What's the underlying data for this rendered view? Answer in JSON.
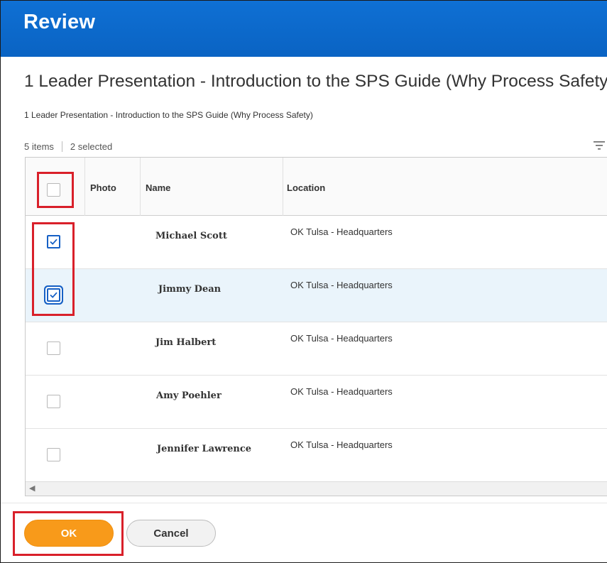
{
  "header": {
    "title": "Review"
  },
  "main_title": "1 Leader Presentation - Introduction to the SPS Guide (Why Process Safety",
  "subtitle": "1 Leader Presentation - Introduction to the SPS Guide (Why Process Safety)",
  "grid": {
    "item_count": "5 items",
    "selected_count": "2 selected",
    "columns": {
      "photo": "Photo",
      "name": "Name",
      "location": "Location"
    },
    "rows": [
      {
        "name": "Michael Scott",
        "location": "OK Tulsa - Headquarters",
        "checked": true
      },
      {
        "name": "Jimmy Dean",
        "location": "OK Tulsa - Headquarters",
        "checked": true
      },
      {
        "name": "Jim Halbert",
        "location": "OK Tulsa - Headquarters",
        "checked": false
      },
      {
        "name": "Amy Poehler",
        "location": "OK Tulsa - Headquarters",
        "checked": false
      },
      {
        "name": "Jennifer Lawrence",
        "location": "OK Tulsa - Headquarters",
        "checked": false
      }
    ],
    "scroll_left_glyph": "◀"
  },
  "footer": {
    "ok_label": "OK",
    "cancel_label": "Cancel"
  },
  "colors": {
    "header_blue": "#0d6ccf",
    "ok_orange": "#f89a1a",
    "check_blue": "#1660c5",
    "annotation_red": "#d9202a",
    "row_highlight": "#eaf4fb"
  }
}
